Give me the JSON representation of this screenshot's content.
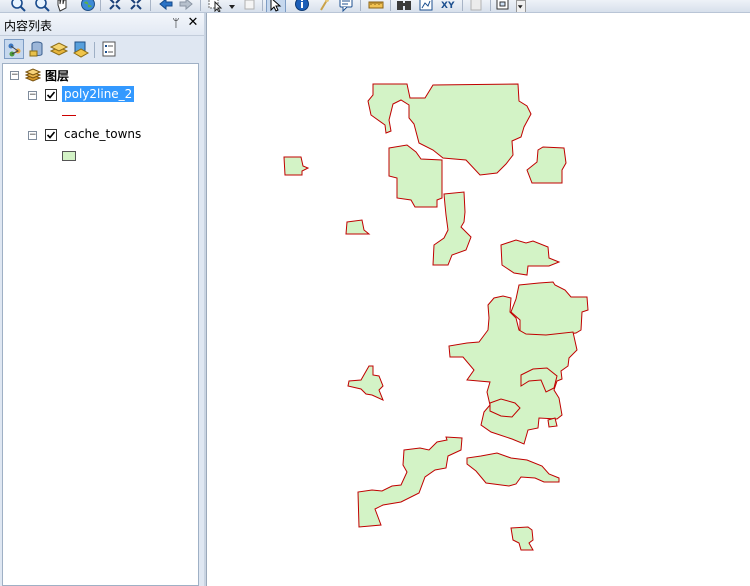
{
  "toolbar": {
    "tools": [
      {
        "name": "zoom-in-icon"
      },
      {
        "name": "zoom-out-icon"
      },
      {
        "name": "pan-icon"
      },
      {
        "name": "full-extent-icon"
      },
      {
        "name": "fixed-zoom-in-icon"
      },
      {
        "name": "fixed-zoom-out-icon"
      },
      {
        "name": "back-extent-icon"
      },
      {
        "name": "forward-extent-icon"
      },
      {
        "name": "select-features-icon"
      },
      {
        "name": "clear-selection-icon"
      },
      {
        "name": "select-elements-icon"
      },
      {
        "name": "identify-icon"
      },
      {
        "name": "hyperlink-icon"
      },
      {
        "name": "html-popup-icon"
      },
      {
        "name": "measure-icon"
      },
      {
        "name": "find-icon"
      },
      {
        "name": "find-route-icon"
      },
      {
        "name": "go-to-xy-icon"
      },
      {
        "name": "time-slider-icon"
      },
      {
        "name": "create-viewer-icon"
      }
    ],
    "xy_label": "XY"
  },
  "toc": {
    "title": "内容列表",
    "pin_glyph": "ᛘ",
    "close_glyph": "✕",
    "tools": [
      "list-by-drawing-order-icon",
      "list-by-source-icon",
      "list-by-visibility-icon",
      "list-by-selection-icon",
      "options-icon"
    ],
    "group": {
      "label": "图层",
      "expanded": true
    },
    "layers": [
      {
        "name": "poly2line_2",
        "checked": true,
        "selected": true,
        "symbol": "line",
        "symbol_color": "#cc0000"
      },
      {
        "name": "cache_towns",
        "checked": true,
        "selected": false,
        "symbol": "polygon",
        "symbol_color": "#d3f3c6"
      }
    ]
  },
  "map": {
    "fill_color": "#d3f3c6",
    "outline_color": "#c00000"
  },
  "colors": {
    "selection": "#3399ff",
    "panel_bg": "#dfe7f2"
  }
}
